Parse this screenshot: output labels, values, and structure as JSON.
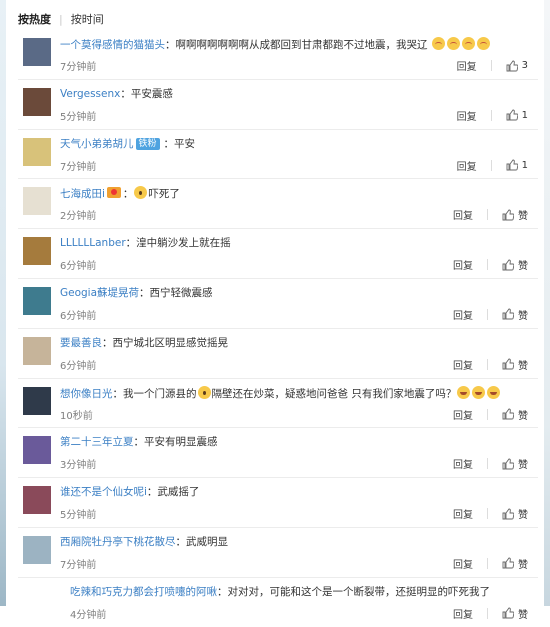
{
  "sort": {
    "hot": "按热度",
    "time": "按时间"
  },
  "labels": {
    "reply": "回复",
    "like": "赞"
  },
  "comments": [
    {
      "user": "一个莫得感情的猫猫头",
      "text": "啊啊啊啊啊啊啊从成都回到甘肃都跑不过地震，我哭辽",
      "emojis": [
        "cry",
        "cry",
        "cry",
        "cry"
      ],
      "time": "7分钟前",
      "likes": "3",
      "avatar": "#5a6a86"
    },
    {
      "user": "Vergessenx",
      "text": "平安震感",
      "time": "5分钟前",
      "likes": "1",
      "avatar": "#6b4a3a"
    },
    {
      "user": "天气小弟弟胡儿",
      "badge": "铁粉",
      "text": "平安",
      "time": "7分钟前",
      "likes": "1",
      "avatar": "#d8c27a"
    },
    {
      "user": "七海成田i",
      "text": "吓死了",
      "time": "2分钟前",
      "likes": "赞",
      "avatar": "#e6e0d2"
    },
    {
      "user": "LLLLLLanber",
      "text": "湟中躺沙发上就在摇",
      "time": "6分钟前",
      "likes": "赞",
      "avatar": "#a57b3d"
    },
    {
      "user": "Geogia蘇堤晃荷",
      "text": "西宁轻微震感",
      "time": "6分钟前",
      "likes": "赞",
      "avatar": "#3e7b8e"
    },
    {
      "user": "要最善良",
      "text": "西宁城北区明显感觉摇晃",
      "time": "6分钟前",
      "likes": "赞",
      "avatar": "#c6b49a"
    },
    {
      "user": "想你像日光",
      "text": "我一个门源县的",
      "text2": "隔壁还在炒菜，疑惑地问爸爸 只有我们家地震了吗？",
      "time": "10秒前",
      "likes": "赞",
      "avatar": "#2f3a4a"
    },
    {
      "user": "第二十三年立夏",
      "text": "平安有明显震感",
      "time": "3分钟前",
      "likes": "赞",
      "avatar": "#6a5a9a"
    },
    {
      "user": "谁还不是个仙女呢i",
      "text": "武威摇了",
      "time": "5分钟前",
      "likes": "赞",
      "avatar": "#8a4a5a"
    },
    {
      "user": "西厢院牡丹亭下桃花散尽",
      "text": "武威明显",
      "time": "7分钟前",
      "likes": "赞",
      "avatar": "#9cb3c2"
    },
    {
      "user": "吃辣和巧克力都会打喷嚏的阿啾",
      "text": "对对对，可能和这个是一个断裂带，还挺明显的吓死我了",
      "time": "4分钟前",
      "likes": "赞",
      "avatar": ""
    }
  ]
}
